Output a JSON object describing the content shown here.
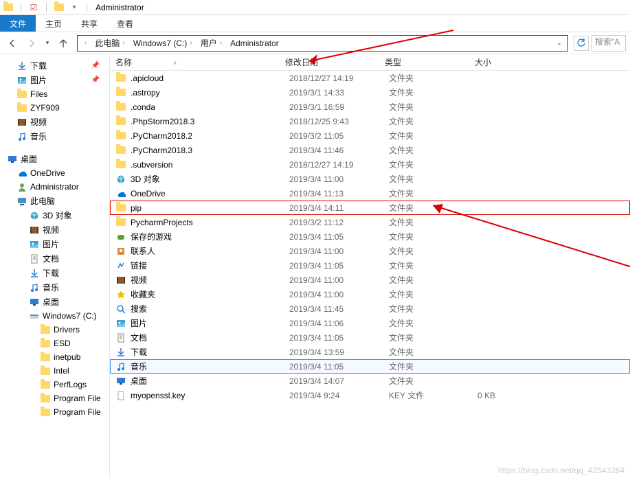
{
  "window": {
    "title": "Administrator"
  },
  "menu": {
    "file": "文件",
    "home": "主页",
    "share": "共享",
    "view": "查看"
  },
  "breadcrumb": [
    "此电脑",
    "Windows7 (C:)",
    "用户",
    "Administrator"
  ],
  "search": {
    "placeholder": "搜索\"A"
  },
  "columns": {
    "name": "名称",
    "date": "修改日期",
    "type": "类型",
    "size": "大小"
  },
  "sidebar": {
    "quick": [
      {
        "label": "下载",
        "icon": "download",
        "pinned": true
      },
      {
        "label": "图片",
        "icon": "pictures",
        "pinned": true
      },
      {
        "label": "Files",
        "icon": "folder",
        "pinned": false
      },
      {
        "label": "ZYF909",
        "icon": "folder",
        "pinned": false
      },
      {
        "label": "视频",
        "icon": "video",
        "pinned": false
      },
      {
        "label": "音乐",
        "icon": "music",
        "pinned": false
      }
    ],
    "desktop_root": "桌面",
    "desktop": [
      {
        "label": "OneDrive",
        "icon": "onedrive"
      },
      {
        "label": "Administrator",
        "icon": "user"
      },
      {
        "label": "此电脑",
        "icon": "thispc"
      }
    ],
    "thispc": [
      {
        "label": "3D 对象",
        "icon": "3d"
      },
      {
        "label": "视频",
        "icon": "video"
      },
      {
        "label": "图片",
        "icon": "pictures"
      },
      {
        "label": "文档",
        "icon": "documents"
      },
      {
        "label": "下载",
        "icon": "download"
      },
      {
        "label": "音乐",
        "icon": "music"
      },
      {
        "label": "桌面",
        "icon": "desktop"
      },
      {
        "label": "Windows7 (C:)",
        "icon": "drive"
      }
    ],
    "drive": [
      {
        "label": "Drivers"
      },
      {
        "label": "ESD"
      },
      {
        "label": "inetpub"
      },
      {
        "label": "Intel"
      },
      {
        "label": "PerfLogs"
      },
      {
        "label": "Program File"
      },
      {
        "label": "Program File"
      }
    ]
  },
  "files": [
    {
      "name": ".apicloud",
      "date": "2018/12/27 14:19",
      "type": "文件夹",
      "size": "",
      "icon": "folder"
    },
    {
      "name": ".astropy",
      "date": "2019/3/1 14:33",
      "type": "文件夹",
      "size": "",
      "icon": "folder"
    },
    {
      "name": ".conda",
      "date": "2019/3/1 16:59",
      "type": "文件夹",
      "size": "",
      "icon": "folder"
    },
    {
      "name": ".PhpStorm2018.3",
      "date": "2018/12/25 9:43",
      "type": "文件夹",
      "size": "",
      "icon": "folder"
    },
    {
      "name": ".PyCharm2018.2",
      "date": "2019/3/2 11:05",
      "type": "文件夹",
      "size": "",
      "icon": "folder"
    },
    {
      "name": ".PyCharm2018.3",
      "date": "2019/3/4 11:46",
      "type": "文件夹",
      "size": "",
      "icon": "folder"
    },
    {
      "name": ".subversion",
      "date": "2018/12/27 14:19",
      "type": "文件夹",
      "size": "",
      "icon": "folder"
    },
    {
      "name": "3D 对象",
      "date": "2019/3/4 11:00",
      "type": "文件夹",
      "size": "",
      "icon": "3d"
    },
    {
      "name": "OneDrive",
      "date": "2019/3/4 11:13",
      "type": "文件夹",
      "size": "",
      "icon": "onedrive"
    },
    {
      "name": "pip",
      "date": "2019/3/4 14:11",
      "type": "文件夹",
      "size": "",
      "icon": "folder",
      "highlight": "red"
    },
    {
      "name": "PycharmProjects",
      "date": "2019/3/2 11:12",
      "type": "文件夹",
      "size": "",
      "icon": "folder"
    },
    {
      "name": "保存的游戏",
      "date": "2019/3/4 11:05",
      "type": "文件夹",
      "size": "",
      "icon": "games"
    },
    {
      "name": "联系人",
      "date": "2019/3/4 11:00",
      "type": "文件夹",
      "size": "",
      "icon": "contacts"
    },
    {
      "name": "链接",
      "date": "2019/3/4 11:05",
      "type": "文件夹",
      "size": "",
      "icon": "links"
    },
    {
      "name": "视频",
      "date": "2019/3/4 11:00",
      "type": "文件夹",
      "size": "",
      "icon": "video"
    },
    {
      "name": "收藏夹",
      "date": "2019/3/4 11:00",
      "type": "文件夹",
      "size": "",
      "icon": "favorites"
    },
    {
      "name": "搜索",
      "date": "2019/3/4 11:45",
      "type": "文件夹",
      "size": "",
      "icon": "search"
    },
    {
      "name": "图片",
      "date": "2019/3/4 11:06",
      "type": "文件夹",
      "size": "",
      "icon": "pictures"
    },
    {
      "name": "文档",
      "date": "2019/3/4 11:05",
      "type": "文件夹",
      "size": "",
      "icon": "documents"
    },
    {
      "name": "下载",
      "date": "2019/3/4 13:59",
      "type": "文件夹",
      "size": "",
      "icon": "download"
    },
    {
      "name": "音乐",
      "date": "2019/3/4 11:05",
      "type": "文件夹",
      "size": "",
      "icon": "music",
      "highlight": "blue"
    },
    {
      "name": "桌面",
      "date": "2019/3/4 14:07",
      "type": "文件夹",
      "size": "",
      "icon": "desktop"
    },
    {
      "name": "myopenssl.key",
      "date": "2019/3/4 9:24",
      "type": "KEY 文件",
      "size": "0 KB",
      "icon": "file"
    }
  ],
  "watermark": "https://blog.csdn.net/qq_42543264"
}
